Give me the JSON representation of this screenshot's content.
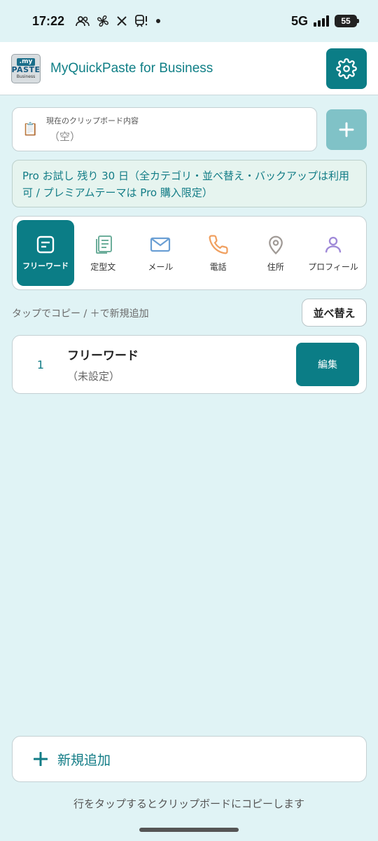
{
  "status_bar": {
    "time": "17:22",
    "network": "5G",
    "battery": "55",
    "icons": [
      "people-icon",
      "fan-icon",
      "x-icon",
      "train-icon",
      "dot-icon"
    ]
  },
  "app_bar": {
    "logo": {
      "my": ".my",
      "paste": "PASTE",
      "business": "Business"
    },
    "title": "MyQuickPaste for Business",
    "settings_icon": "gear-icon"
  },
  "clipboard": {
    "label": "現在のクリップボード内容",
    "value": "（空）",
    "icon": "clipboard-icon"
  },
  "add_button": {
    "glyph": "+"
  },
  "pro_banner": {
    "text": "Pro お試し 残り 30 日（全カテゴリ・並べ替え・バックアップは利用可 / プレミアムテーマは Pro 購入限定）"
  },
  "tabs": [
    {
      "label": "フリーワード",
      "icon": "note-icon",
      "active": true
    },
    {
      "label": "定型文",
      "icon": "documents-icon",
      "active": false
    },
    {
      "label": "メール",
      "icon": "mail-icon",
      "active": false
    },
    {
      "label": "電話",
      "icon": "phone-icon",
      "active": false
    },
    {
      "label": "住所",
      "icon": "location-pin-icon",
      "active": false
    },
    {
      "label": "プロフィール",
      "icon": "person-icon",
      "active": false
    }
  ],
  "hint": "タップでコピー / ＋で新規追加",
  "sort_label": "並べ替え",
  "items": [
    {
      "num": "1",
      "title": "フリーワード",
      "sub": "（未設定）",
      "edit_label": "編集"
    }
  ],
  "bottom": {
    "add_glyph": "+",
    "add_label": "新規追加",
    "footer_hint": "行をタップするとクリップボードにコピーします"
  },
  "colors": {
    "background": "#e0f3f5",
    "accent": "#0b7d86",
    "accent_light": "#80c2c7",
    "banner_bg": "#e6f4ef"
  }
}
